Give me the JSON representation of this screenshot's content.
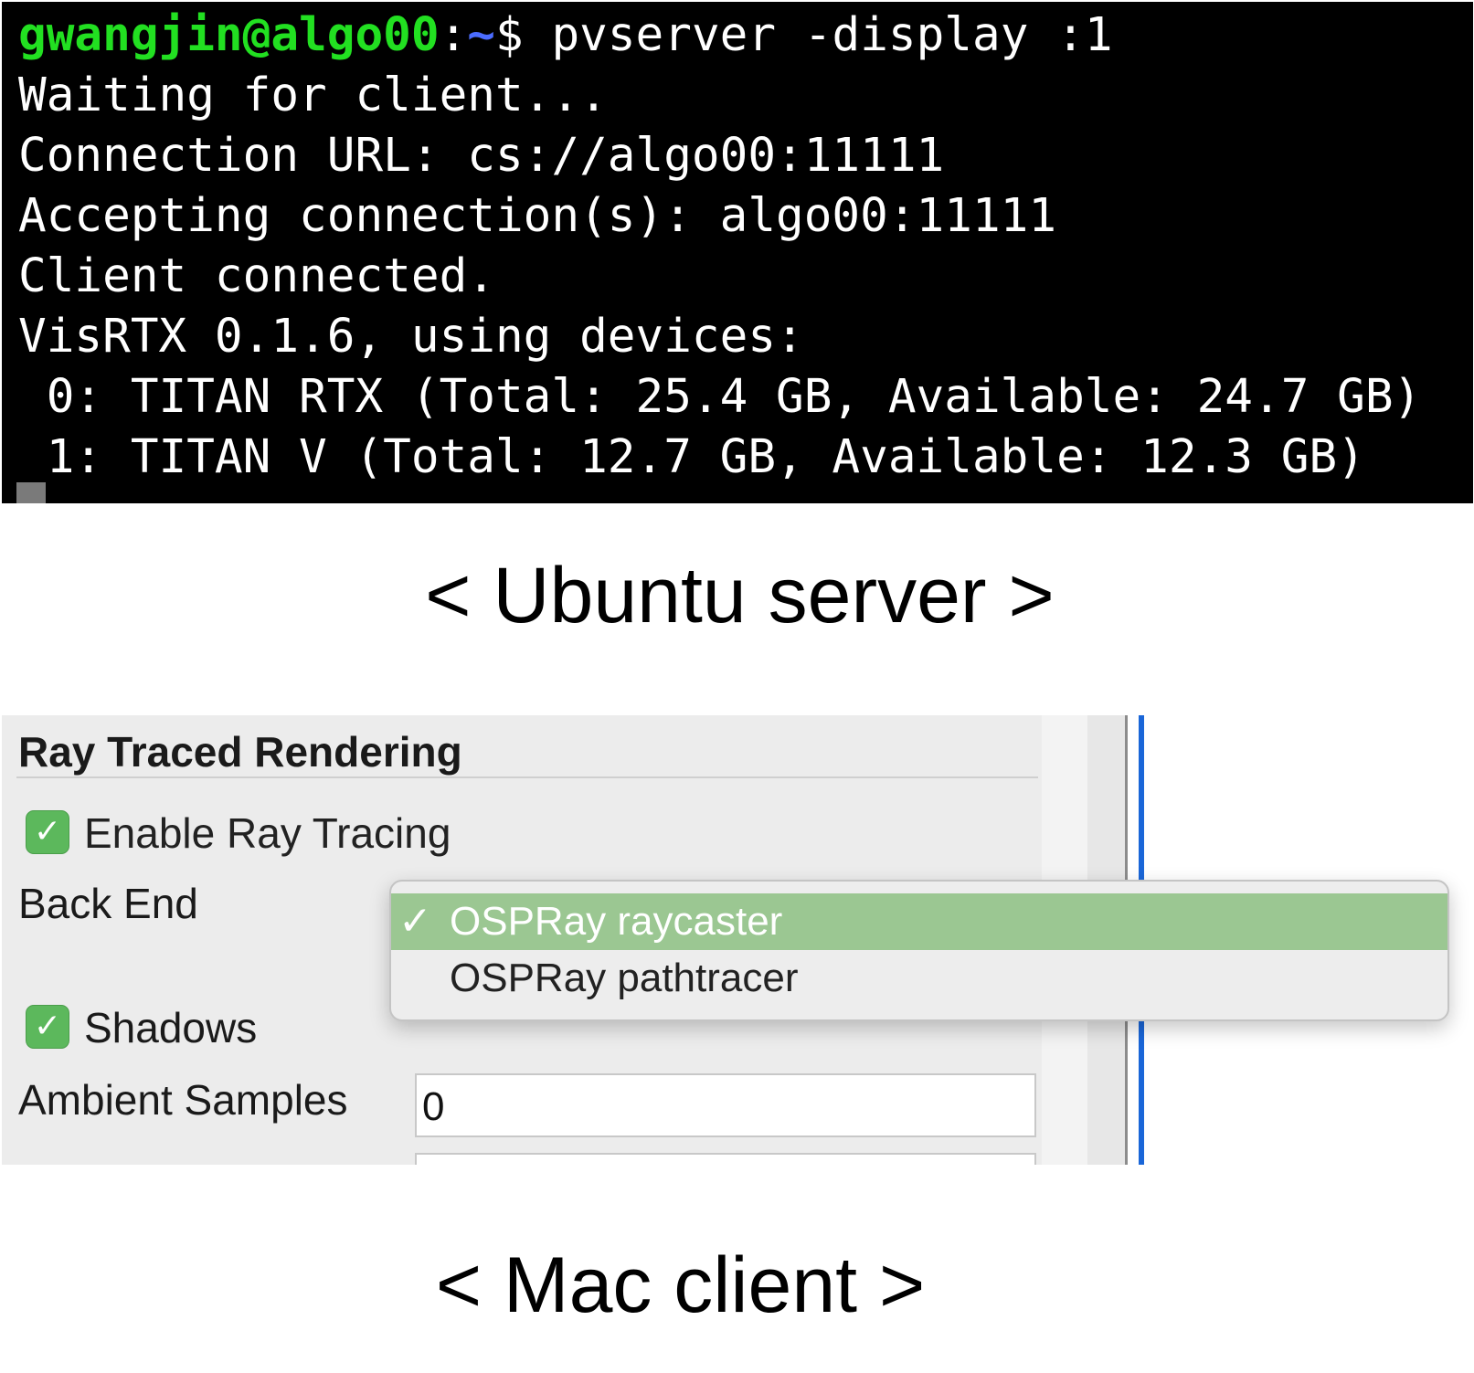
{
  "terminal": {
    "prompt_user": "gwangjin@algo00",
    "prompt_colon": ":",
    "prompt_path": "~",
    "prompt_dollar": "$",
    "command": " pvserver -display :1",
    "lines": [
      "Waiting for client...",
      "Connection URL: cs://algo00:11111",
      "Accepting connection(s): algo00:11111",
      "Client connected.",
      "VisRTX 0.1.6, using devices:",
      " 0: TITAN RTX (Total: 25.4 GB, Available: 24.7 GB)",
      " 1: TITAN V (Total: 12.7 GB, Available: 12.3 GB)"
    ]
  },
  "captions": {
    "server": "< Ubuntu server >",
    "client": "< Mac client >"
  },
  "panel": {
    "section_title": "Ray Traced Rendering",
    "enable_ray_tracing": {
      "label": "Enable Ray Tracing",
      "checked": true,
      "check_glyph": "✓"
    },
    "back_end": {
      "label": "Back End",
      "options": [
        {
          "label": "OSPRay raycaster",
          "selected": true,
          "check_glyph": "✓"
        },
        {
          "label": "OSPRay pathtracer",
          "selected": false
        }
      ]
    },
    "shadows": {
      "label": "Shadows",
      "checked": true,
      "check_glyph": "✓"
    },
    "ambient_samples": {
      "label": "Ambient Samples",
      "value": "0"
    }
  },
  "colors": {
    "terminal_bg": "#000000",
    "prompt_user": "#22e021",
    "prompt_path": "#4b6cff",
    "checkbox_green": "#5cb85c",
    "selected_item": "#9bc792",
    "blue_line": "#1a66d8"
  }
}
